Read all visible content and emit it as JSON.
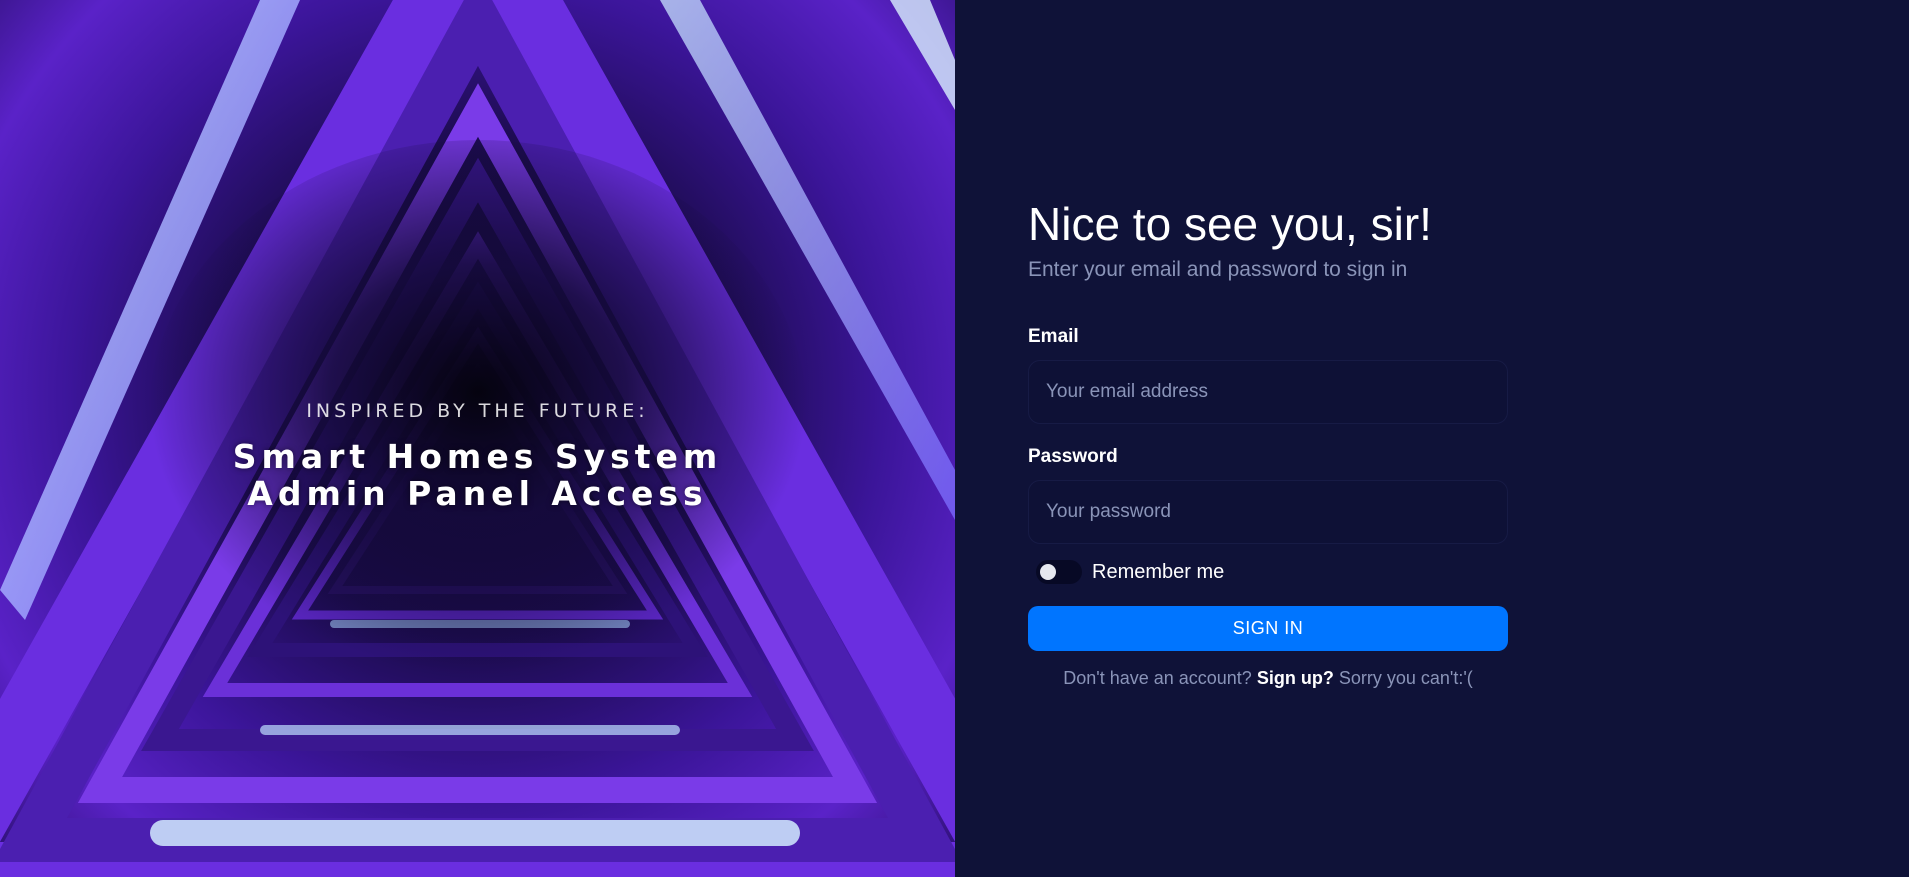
{
  "hero": {
    "kicker": "INSPIRED BY THE FUTURE:",
    "title_line1": "Smart Homes System",
    "title_line2": "Admin Panel Access"
  },
  "form": {
    "heading": "Nice to see you, sir!",
    "subheading": "Enter your email and password to sign in",
    "email_label": "Email",
    "email_placeholder": "Your email address",
    "email_value": "",
    "password_label": "Password",
    "password_placeholder": "Your password",
    "password_value": "",
    "remember_label": "Remember me",
    "remember_checked": false,
    "signin_label": "SIGN IN",
    "footer_prefix": "Don't have an account?",
    "footer_link": "Sign up?",
    "footer_suffix": "Sorry you can't:'("
  },
  "colors": {
    "page_background": "#0f1238",
    "accent": "#0075ff",
    "muted_text": "#8a94b8",
    "hero_purple": "#5a22c8"
  },
  "icons": {
    "remember_toggle": "toggle-switch-icon"
  }
}
